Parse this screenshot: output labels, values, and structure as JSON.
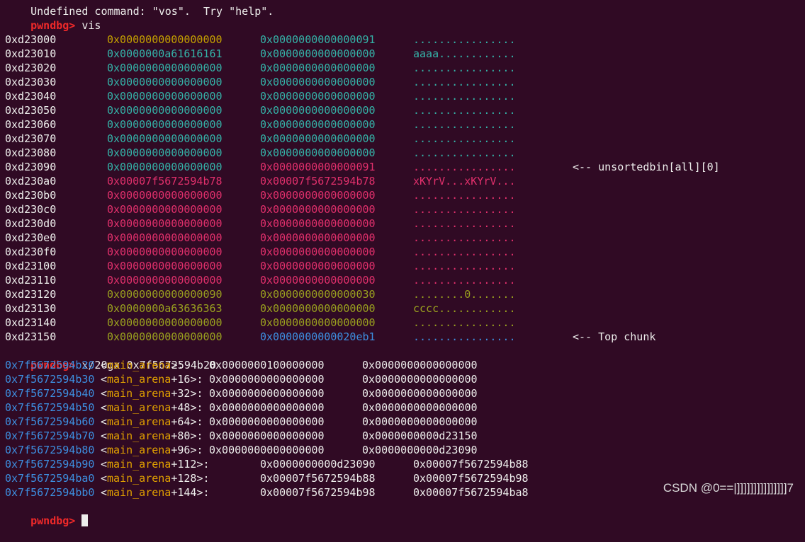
{
  "terminal": {
    "top_line": "Undefined command: \"vos\".  Try \"help\".",
    "prompt": "pwndbg>",
    "vis_command": " vis",
    "heap_rows": [
      {
        "addr": "0xd23000",
        "w1": "0x0000000000000000",
        "w2": "0x0000000000000091",
        "ascii": "................",
        "c1": "yellow",
        "c2": "teal",
        "ca": "teal",
        "note": ""
      },
      {
        "addr": "0xd23010",
        "w1": "0x0000000a61616161",
        "w2": "0x0000000000000000",
        "ascii": "aaaa............",
        "c1": "teal",
        "c2": "teal",
        "ca": "teal",
        "note": ""
      },
      {
        "addr": "0xd23020",
        "w1": "0x0000000000000000",
        "w2": "0x0000000000000000",
        "ascii": "................",
        "c1": "teal",
        "c2": "teal",
        "ca": "teal",
        "note": ""
      },
      {
        "addr": "0xd23030",
        "w1": "0x0000000000000000",
        "w2": "0x0000000000000000",
        "ascii": "................",
        "c1": "teal",
        "c2": "teal",
        "ca": "teal",
        "note": ""
      },
      {
        "addr": "0xd23040",
        "w1": "0x0000000000000000",
        "w2": "0x0000000000000000",
        "ascii": "................",
        "c1": "teal",
        "c2": "teal",
        "ca": "teal",
        "note": ""
      },
      {
        "addr": "0xd23050",
        "w1": "0x0000000000000000",
        "w2": "0x0000000000000000",
        "ascii": "................",
        "c1": "teal",
        "c2": "teal",
        "ca": "teal",
        "note": ""
      },
      {
        "addr": "0xd23060",
        "w1": "0x0000000000000000",
        "w2": "0x0000000000000000",
        "ascii": "................",
        "c1": "teal",
        "c2": "teal",
        "ca": "teal",
        "note": ""
      },
      {
        "addr": "0xd23070",
        "w1": "0x0000000000000000",
        "w2": "0x0000000000000000",
        "ascii": "................",
        "c1": "teal",
        "c2": "teal",
        "ca": "teal",
        "note": ""
      },
      {
        "addr": "0xd23080",
        "w1": "0x0000000000000000",
        "w2": "0x0000000000000000",
        "ascii": "................",
        "c1": "teal",
        "c2": "teal",
        "ca": "teal",
        "note": ""
      },
      {
        "addr": "0xd23090",
        "w1": "0x0000000000000000",
        "w2": "0x0000000000000091",
        "ascii": "................",
        "c1": "teal",
        "c2": "pink",
        "ca": "pink",
        "note": "<-- unsortedbin[all][0]"
      },
      {
        "addr": "0xd230a0",
        "w1": "0x00007f5672594b78",
        "w2": "0x00007f5672594b78",
        "ascii": "xKYrV...xKYrV...",
        "c1": "pink",
        "c2": "pink",
        "ca": "pink",
        "note": ""
      },
      {
        "addr": "0xd230b0",
        "w1": "0x0000000000000000",
        "w2": "0x0000000000000000",
        "ascii": "................",
        "c1": "pink",
        "c2": "pink",
        "ca": "pink",
        "note": ""
      },
      {
        "addr": "0xd230c0",
        "w1": "0x0000000000000000",
        "w2": "0x0000000000000000",
        "ascii": "................",
        "c1": "pink",
        "c2": "pink",
        "ca": "pink",
        "note": ""
      },
      {
        "addr": "0xd230d0",
        "w1": "0x0000000000000000",
        "w2": "0x0000000000000000",
        "ascii": "................",
        "c1": "pink",
        "c2": "pink",
        "ca": "pink",
        "note": ""
      },
      {
        "addr": "0xd230e0",
        "w1": "0x0000000000000000",
        "w2": "0x0000000000000000",
        "ascii": "................",
        "c1": "pink",
        "c2": "pink",
        "ca": "pink",
        "note": ""
      },
      {
        "addr": "0xd230f0",
        "w1": "0x0000000000000000",
        "w2": "0x0000000000000000",
        "ascii": "................",
        "c1": "pink",
        "c2": "pink",
        "ca": "pink",
        "note": ""
      },
      {
        "addr": "0xd23100",
        "w1": "0x0000000000000000",
        "w2": "0x0000000000000000",
        "ascii": "................",
        "c1": "pink",
        "c2": "pink",
        "ca": "pink",
        "note": ""
      },
      {
        "addr": "0xd23110",
        "w1": "0x0000000000000000",
        "w2": "0x0000000000000000",
        "ascii": "................",
        "c1": "pink",
        "c2": "pink",
        "ca": "pink",
        "note": ""
      },
      {
        "addr": "0xd23120",
        "w1": "0x0000000000000090",
        "w2": "0x0000000000000030",
        "ascii": "........0.......",
        "c1": "olive",
        "c2": "olive",
        "ca": "olive",
        "note": ""
      },
      {
        "addr": "0xd23130",
        "w1": "0x0000000a63636363",
        "w2": "0x0000000000000000",
        "ascii": "cccc............",
        "c1": "olive",
        "c2": "olive",
        "ca": "olive",
        "note": ""
      },
      {
        "addr": "0xd23140",
        "w1": "0x0000000000000000",
        "w2": "0x0000000000000000",
        "ascii": "................",
        "c1": "olive",
        "c2": "olive",
        "ca": "olive",
        "note": ""
      },
      {
        "addr": "0xd23150",
        "w1": "0x0000000000000000",
        "w2": "0x0000000000020eb1",
        "ascii": "................",
        "c1": "olive",
        "c2": "blue",
        "ca": "blue",
        "note": "<-- Top chunk"
      }
    ],
    "gx_command": " x/20gx 0x7f5672594b20",
    "gx_rows": [
      {
        "addr": "0x7f5672594b20",
        "sym": "main_arena",
        "off": "",
        "v1": "0x0000000100000000",
        "v2": "0x0000000000000000",
        "wide": false
      },
      {
        "addr": "0x7f5672594b30",
        "sym": "main_arena",
        "off": "+16",
        "v1": "0x0000000000000000",
        "v2": "0x0000000000000000",
        "wide": false
      },
      {
        "addr": "0x7f5672594b40",
        "sym": "main_arena",
        "off": "+32",
        "v1": "0x0000000000000000",
        "v2": "0x0000000000000000",
        "wide": false
      },
      {
        "addr": "0x7f5672594b50",
        "sym": "main_arena",
        "off": "+48",
        "v1": "0x0000000000000000",
        "v2": "0x0000000000000000",
        "wide": false
      },
      {
        "addr": "0x7f5672594b60",
        "sym": "main_arena",
        "off": "+64",
        "v1": "0x0000000000000000",
        "v2": "0x0000000000000000",
        "wide": false
      },
      {
        "addr": "0x7f5672594b70",
        "sym": "main_arena",
        "off": "+80",
        "v1": "0x0000000000000000",
        "v2": "0x0000000000d23150",
        "wide": false
      },
      {
        "addr": "0x7f5672594b80",
        "sym": "main_arena",
        "off": "+96",
        "v1": "0x0000000000000000",
        "v2": "0x0000000000d23090",
        "wide": false
      },
      {
        "addr": "0x7f5672594b90",
        "sym": "main_arena",
        "off": "+112",
        "v1": "0x0000000000d23090",
        "v2": "0x00007f5672594b88",
        "wide": true
      },
      {
        "addr": "0x7f5672594ba0",
        "sym": "main_arena",
        "off": "+128",
        "v1": "0x00007f5672594b88",
        "v2": "0x00007f5672594b98",
        "wide": true
      },
      {
        "addr": "0x7f5672594bb0",
        "sym": "main_arena",
        "off": "+144",
        "v1": "0x00007f5672594b98",
        "v2": "0x00007f5672594ba8",
        "wide": true
      }
    ]
  },
  "watermark": "CSDN @0==|]]]]]]]]]]]]]]]7",
  "colors": {
    "background": "#300a24",
    "teal": "#34b3a8",
    "yellow": "#c4a000",
    "pink": "#e2306c",
    "olive": "#9aa11f",
    "blue": "#3d8fe0",
    "prompt": "#ef2929"
  }
}
